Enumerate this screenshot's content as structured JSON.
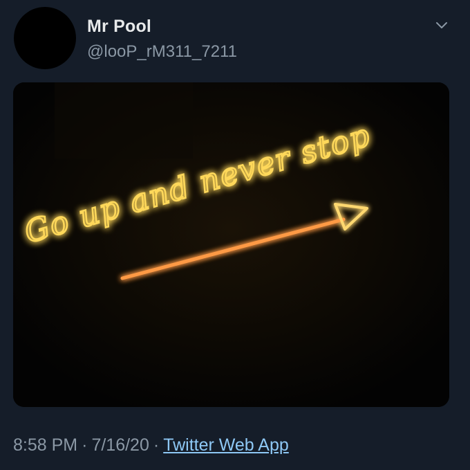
{
  "tweet": {
    "display_name": "Mr Pool",
    "handle": "@looP_rM311_7211",
    "menu_icon": "chevron-down-icon",
    "media": {
      "neon_text": "Go up and never stop",
      "neon_color": "#ffd85a",
      "arrow_color": "#ff9a45"
    },
    "time": "8:58 PM",
    "date": "7/16/20",
    "separator": "·",
    "source": "Twitter Web App"
  },
  "colors": {
    "background": "#151d29",
    "primary_text": "#e7e9ea",
    "secondary_text": "#8b98a5",
    "link": "#8ec8f5"
  }
}
